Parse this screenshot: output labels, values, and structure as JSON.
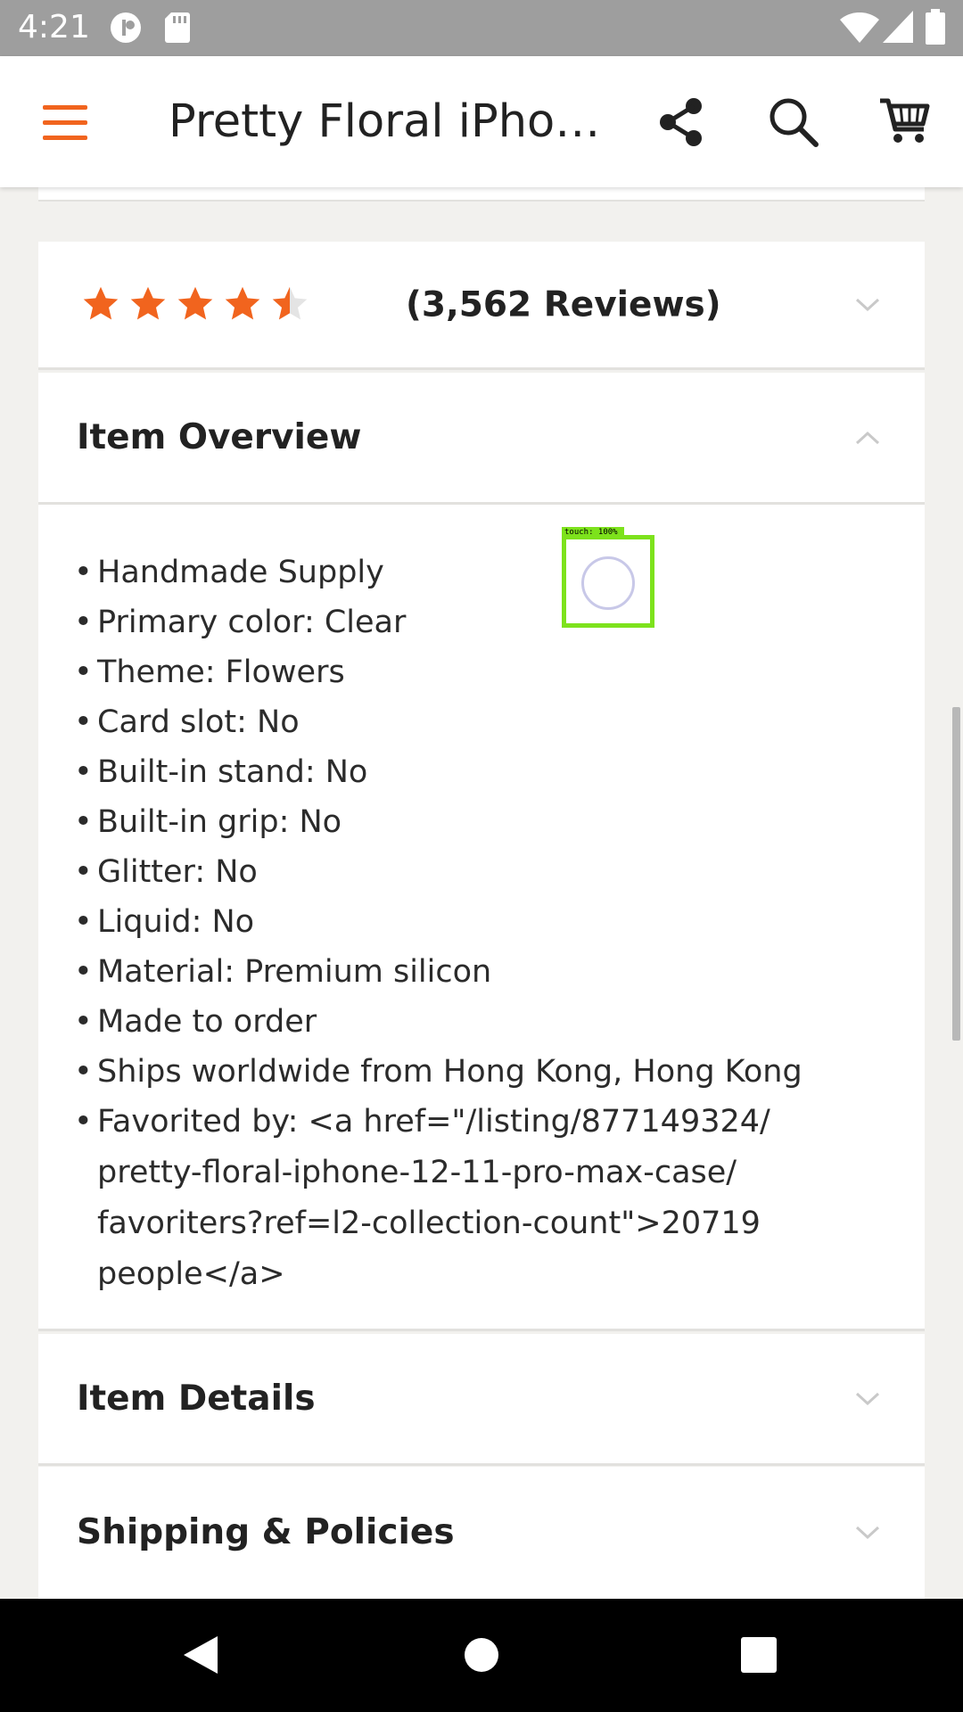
{
  "status_bar": {
    "time": "4:21",
    "icons": [
      "data-saver-icon",
      "sd-card-icon",
      "wifi-icon",
      "signal-icon",
      "battery-icon"
    ]
  },
  "app_bar": {
    "title": "Pretty Floral iPho…",
    "icons": [
      "menu-icon",
      "share-icon",
      "search-icon",
      "cart-icon"
    ],
    "accent_color": "#f1641e"
  },
  "reviews": {
    "rating": 4.5,
    "max_rating": 5,
    "star_color": "#f1641e",
    "count_label": "(3,562 Reviews)"
  },
  "sections": {
    "overview": {
      "title": "Item Overview",
      "expanded": true
    },
    "details": {
      "title": "Item Details",
      "expanded": false
    },
    "shipping": {
      "title": "Shipping & Policies",
      "expanded": false
    }
  },
  "overview_items": [
    "Handmade Supply",
    "Primary color: Clear",
    "Theme: Flowers",
    "Card slot: No",
    "Built-in stand: No",
    "Built-in grip: No",
    "Glitter: No",
    "Liquid: No",
    "Material: Premium silicon",
    "Made to order",
    "Ships worldwide from Hong Kong, Hong Kong"
  ],
  "favorited_lines": [
    "Favorited by: <a href=\"/listing/877149324/",
    "pretty-floral-iphone-12-11-pro-max-case/",
    "favoriters?ref=l2-collection-count\">20719",
    "people</a>"
  ],
  "touch_overlay": {
    "label": "touch: 100%",
    "color": "#7de21c"
  },
  "nav_bar": {
    "buttons": [
      "back-icon",
      "home-icon",
      "recents-icon"
    ]
  }
}
